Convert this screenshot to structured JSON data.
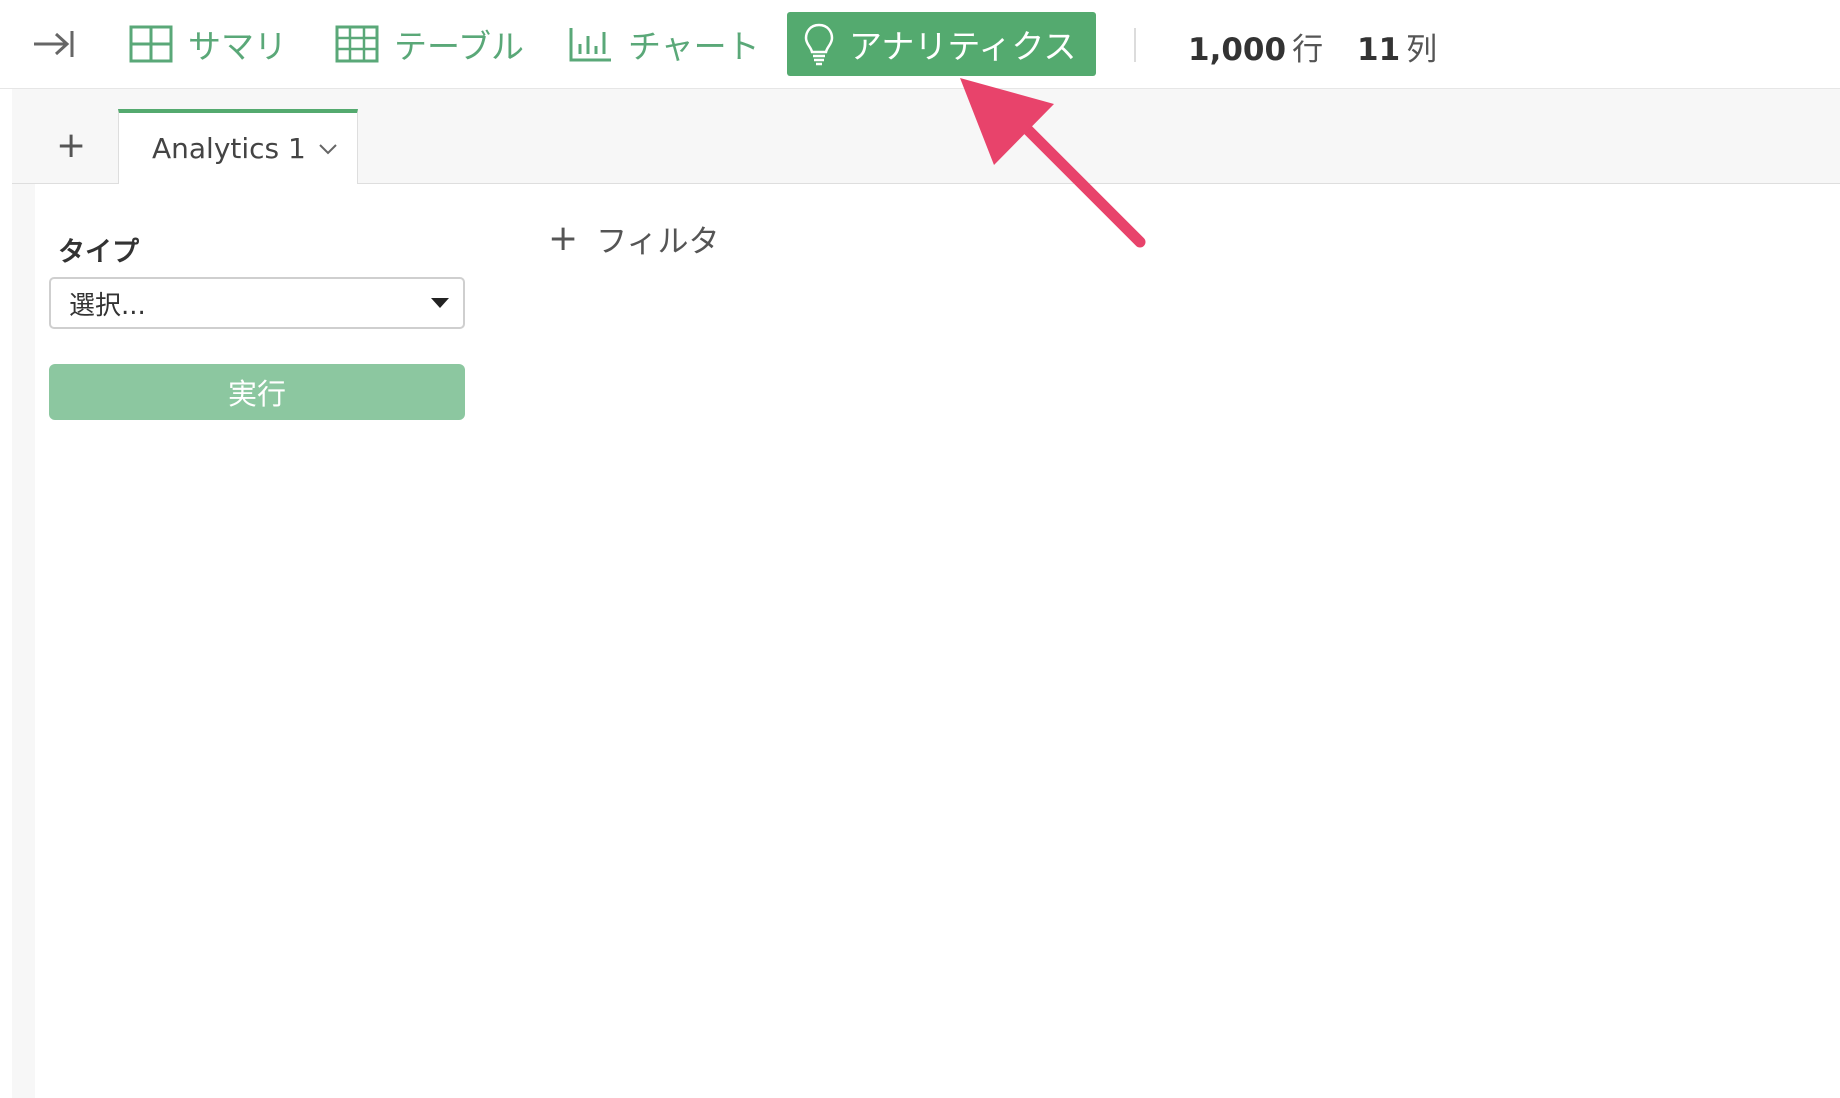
{
  "toolbar": {
    "collapse_icon": "collapse-panel-icon",
    "items": [
      {
        "label": "サマリ",
        "icon": "summary-grid-icon"
      },
      {
        "label": "テーブル",
        "icon": "table-icon"
      },
      {
        "label": "チャート",
        "icon": "bar-chart-icon"
      },
      {
        "label": "アナリティクス",
        "icon": "lightbulb-icon",
        "active": true
      }
    ],
    "rows": {
      "value": "1,000",
      "unit": "行"
    },
    "cols": {
      "value": "11",
      "unit": "列"
    }
  },
  "tabs": {
    "add_icon": "plus-icon",
    "items": [
      {
        "label": "Analytics 1",
        "icon": "chevron-down-icon"
      }
    ]
  },
  "panel": {
    "type_label": "タイプ",
    "select_value": "選択...",
    "run_label": "実行",
    "filter_label": "フィルタ"
  },
  "colors": {
    "accent": "#54aa6f",
    "accent_light": "#8cc7a0",
    "annotation_arrow": "#e8436b"
  }
}
